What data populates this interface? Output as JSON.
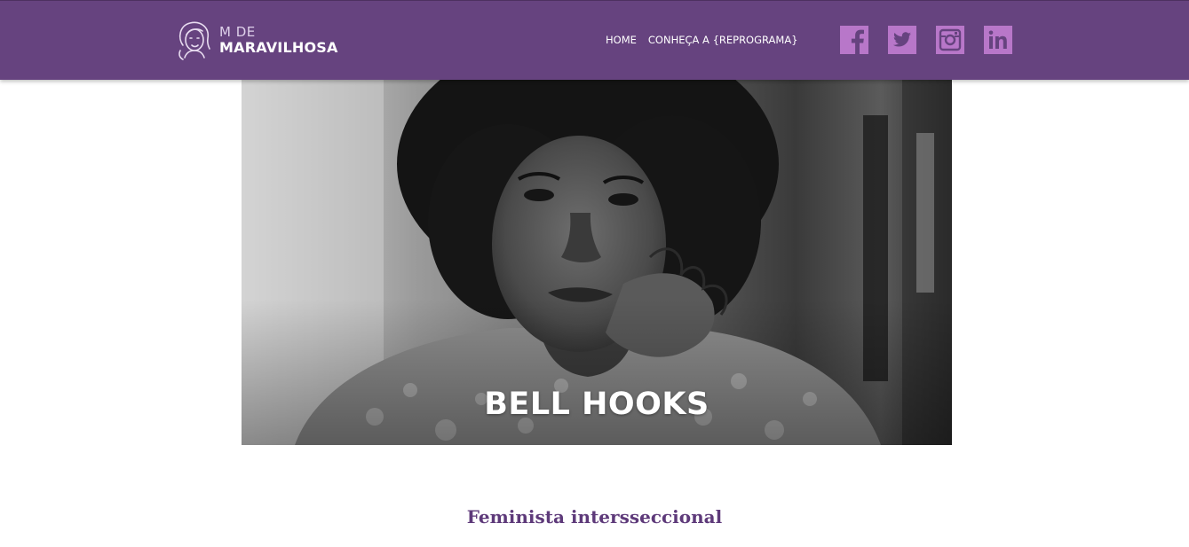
{
  "header": {
    "logo": {
      "line1": "M DE",
      "line2": "MARAVILHOSA"
    },
    "nav": [
      {
        "label": "HOME"
      },
      {
        "label": "CONHEÇA A {REPROGRAMA}"
      }
    ],
    "social": [
      {
        "icon": "facebook-icon"
      },
      {
        "icon": "twitter-icon"
      },
      {
        "icon": "instagram-icon"
      },
      {
        "icon": "linkedin-icon"
      }
    ],
    "colors": {
      "bar": "#66437f",
      "social_icon": "#b877c9"
    }
  },
  "hero": {
    "title": "BELL HOOKS"
  },
  "content": {
    "subtitle": "Feminista intersseccional",
    "subtitle_color": "#5e3a7a"
  }
}
